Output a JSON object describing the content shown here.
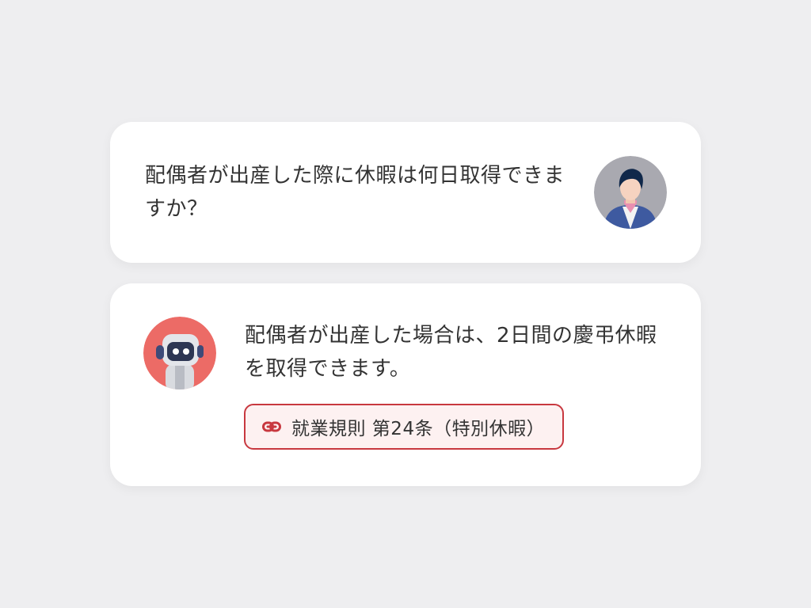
{
  "messages": {
    "user": {
      "text": "配偶者が出産した際に休暇は何日取得できますか？",
      "avatar_icon": "person-avatar-icon"
    },
    "bot": {
      "text": "配偶者が出産した場合は、2日間の慶弔休暇を取得できます。",
      "avatar_icon": "robot-avatar-icon",
      "source": {
        "icon": "link-icon",
        "label": "就業規則 第24条（特別休暇）"
      }
    }
  },
  "colors": {
    "background": "#eeeef0",
    "card": "#ffffff",
    "accent": "#c8383f",
    "chip_background": "#fdf1f1",
    "bot_avatar_bg": "#ec6b66",
    "user_avatar_bg": "#a9a9b0"
  }
}
